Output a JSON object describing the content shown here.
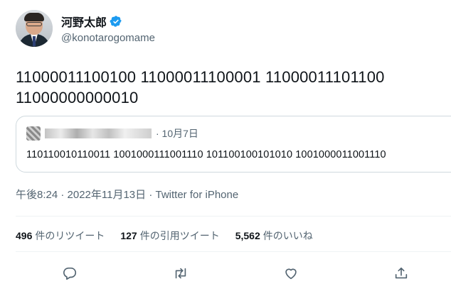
{
  "author": {
    "display_name": "河野太郎",
    "handle": "@konotarogomame",
    "verified": true
  },
  "tweet": {
    "text_line1": "11000011100100 11000011100001 11000011101100",
    "text_line2": "11000000000010"
  },
  "quote": {
    "date": "· 10月7日",
    "text": "110110010110011 1001000111001110 101100100101010 1001000011001110"
  },
  "meta": {
    "timestamp": "午後8:24 · 2022年11月13日 · Twitter for iPhone"
  },
  "stats": [
    {
      "value": "496",
      "label": "件のリツイート"
    },
    {
      "value": "127",
      "label": "件の引用ツイート"
    },
    {
      "value": "5,562",
      "label": "件のいいね"
    }
  ],
  "actions": [
    "reply-icon",
    "retweet-icon",
    "like-icon",
    "share-icon"
  ],
  "colors": {
    "text": "#0f1419",
    "secondary": "#536471",
    "verified": "#1d9bf0",
    "border": "#cfd9de"
  }
}
